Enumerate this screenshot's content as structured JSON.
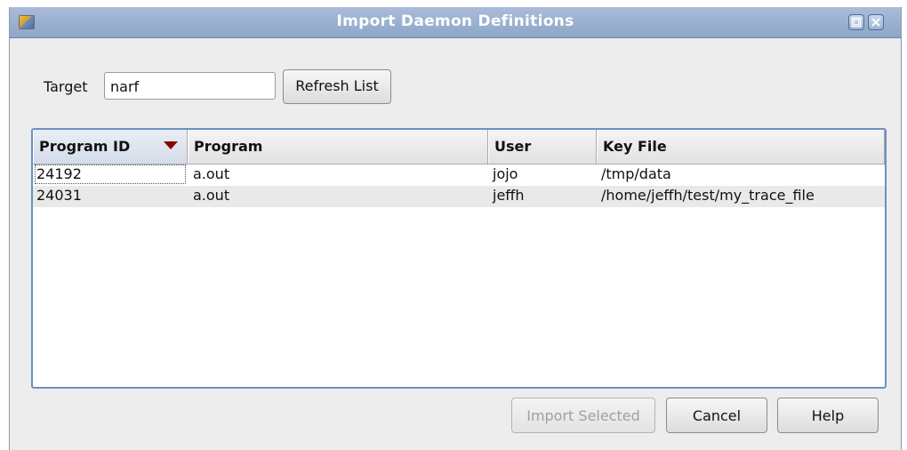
{
  "window": {
    "title": "Import Daemon Definitions",
    "icons": {
      "app": "app-icon",
      "maximize": "maximize-icon",
      "close": "close-icon"
    }
  },
  "target": {
    "label": "Target",
    "value": "narf"
  },
  "buttons": {
    "refresh": "Refresh List",
    "import": "Import Selected",
    "cancel": "Cancel",
    "help": "Help"
  },
  "table": {
    "columns": [
      "Program ID",
      "Program",
      "User",
      "Key File"
    ],
    "sort": {
      "column": "Program ID",
      "direction": "descending",
      "icon": "sort-down-arrow-icon",
      "color": "#8b0000"
    },
    "rows": [
      {
        "program_id": "24192",
        "program": "a.out",
        "user": "jojo",
        "key_file": "/tmp/data"
      },
      {
        "program_id": "24031",
        "program": "a.out",
        "user": "jeffh",
        "key_file": "/home/jeffh/test/my_trace_file"
      }
    ]
  },
  "colors": {
    "titlebar": "#9fb4d3",
    "title_text": "#ffffff",
    "table_border": "#6e8fbf",
    "alt_row": "#e9eae8",
    "dialog_bg": "#ededed"
  }
}
